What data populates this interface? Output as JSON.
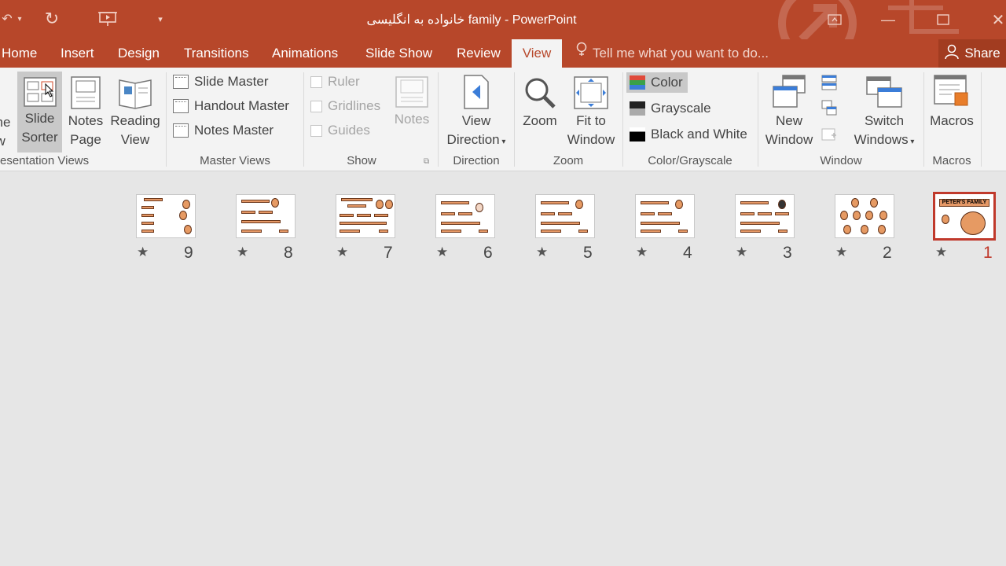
{
  "window": {
    "title": "خانواده به انگلیسی family - PowerPoint"
  },
  "tabs": [
    "Home",
    "Insert",
    "Design",
    "Transitions",
    "Animations",
    "Slide Show",
    "Review",
    "View"
  ],
  "active_tab": "View",
  "tell_me": "Tell me what you want to do...",
  "share": "Share",
  "ribbon": {
    "presentation_views": {
      "label": "esentation Views",
      "normal_partial_line1": "ne",
      "normal_partial_line2": "w",
      "slide_sorter_line1": "Slide",
      "slide_sorter_line2": "Sorter",
      "notes_page_line1": "Notes",
      "notes_page_line2": "Page",
      "reading_view_line1": "Reading",
      "reading_view_line2": "View"
    },
    "master_views": {
      "label": "Master Views",
      "slide_master": "Slide Master",
      "handout_master": "Handout Master",
      "notes_master": "Notes Master"
    },
    "show": {
      "label": "Show",
      "ruler": "Ruler",
      "gridlines": "Gridlines",
      "guides": "Guides",
      "notes": "Notes"
    },
    "direction": {
      "label": "Direction",
      "view_direction_line1": "View",
      "view_direction_line2": "Direction"
    },
    "zoom": {
      "label": "Zoom",
      "zoom": "Zoom",
      "fit_line1": "Fit to",
      "fit_line2": "Window"
    },
    "color": {
      "label": "Color/Grayscale",
      "color": "Color",
      "grayscale": "Grayscale",
      "black_white": "Black and White"
    },
    "window": {
      "label": "Window",
      "new_window_line1": "New",
      "new_window_line2": "Window",
      "switch_line1": "Switch",
      "switch_line2": "Windows"
    },
    "macros": {
      "label": "Macros",
      "macros": "Macros"
    }
  },
  "slides": [
    {
      "number": "9",
      "title": "MATCH"
    },
    {
      "number": "8",
      "title": "WHO IS Mother?"
    },
    {
      "number": "7",
      "title": "WHO ARE Robert AND Pamela?"
    },
    {
      "number": "6",
      "title": "WHO IS Ria?"
    },
    {
      "number": "5",
      "title": "WHO IS Nina?"
    },
    {
      "number": "4",
      "title": "WHO IS Samuel?"
    },
    {
      "number": "3",
      "title": "WHO IS Albert?"
    },
    {
      "number": "2",
      "title": ""
    },
    {
      "number": "1",
      "title": "PETER'S FAMILY"
    }
  ],
  "selected_slide": "1",
  "colors": {
    "accent": "#b7472a",
    "selection": "#c0392b"
  }
}
